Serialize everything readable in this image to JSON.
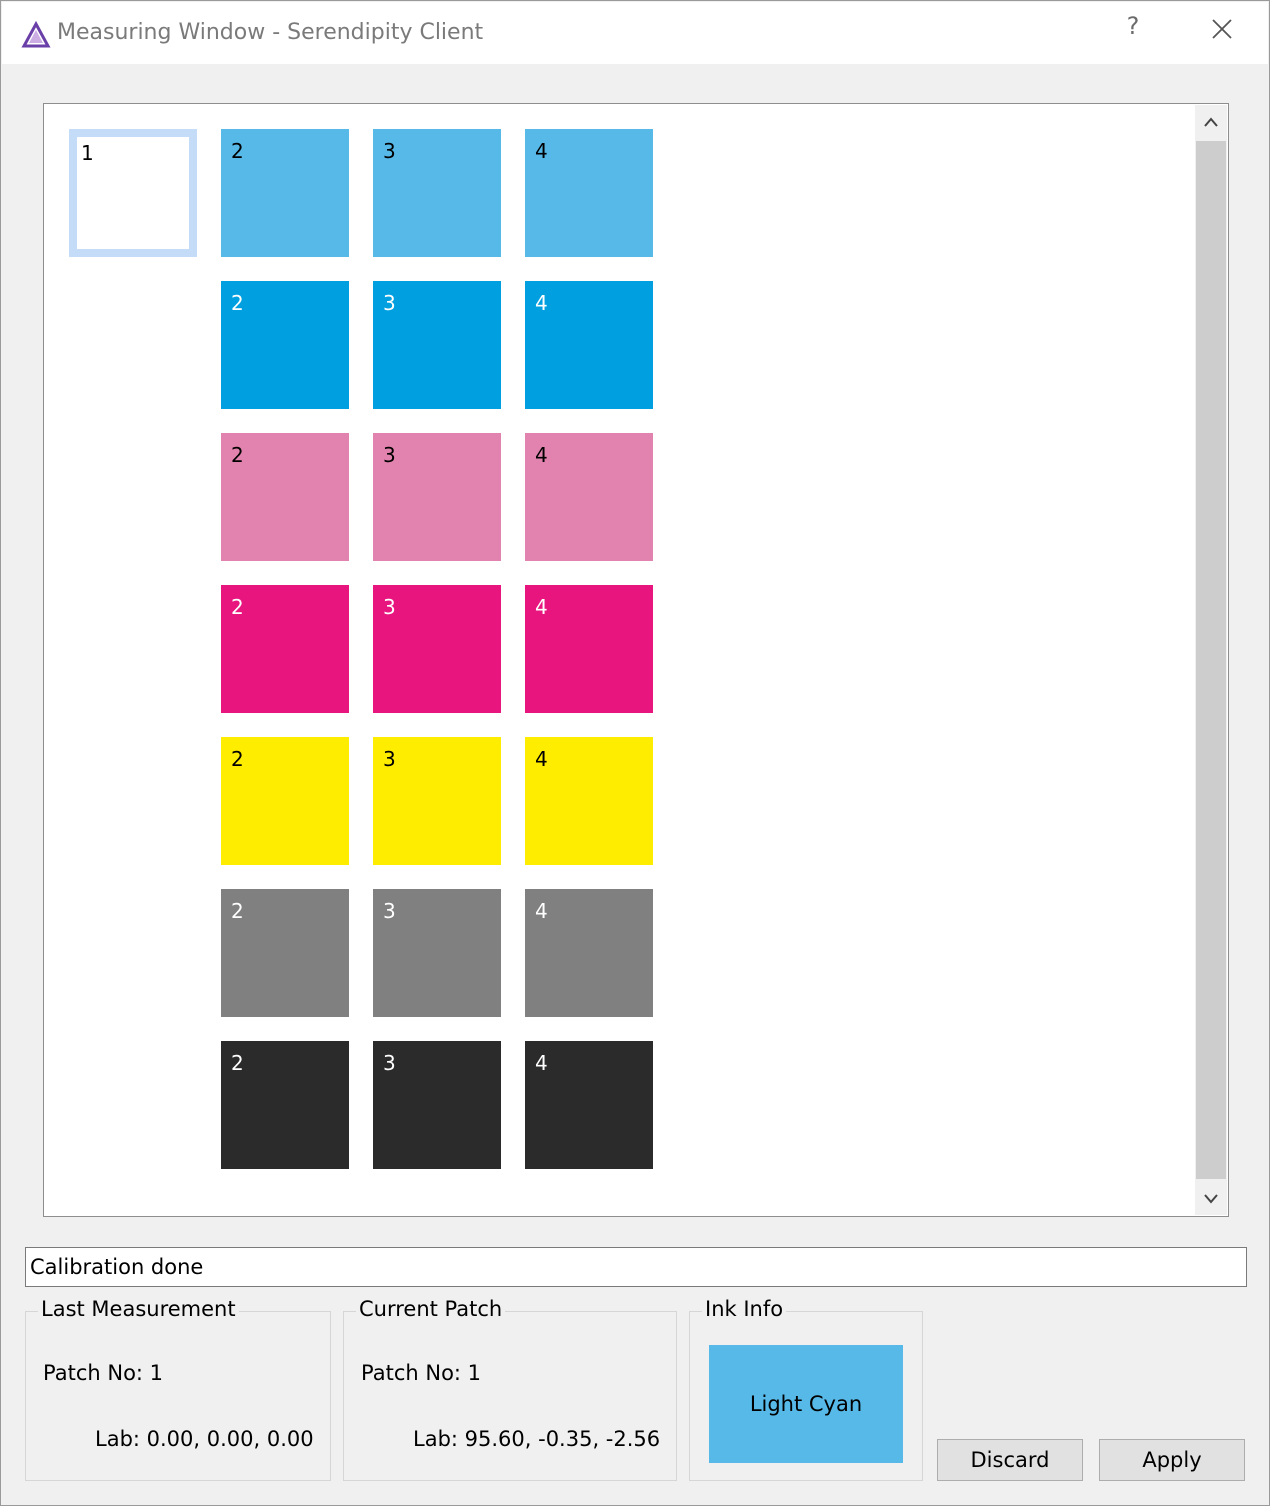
{
  "window": {
    "title": "Measuring Window - Serendipity Client",
    "help_glyph": "?"
  },
  "patches": {
    "first": {
      "label": "1",
      "color": "#ffffff",
      "text_color": "#000000"
    },
    "rows": [
      {
        "name": "light-cyan",
        "color": "#56b9e8",
        "text_color": "#000000",
        "labels": [
          "2",
          "3",
          "4"
        ]
      },
      {
        "name": "cyan",
        "color": "#00a0e0",
        "text_color": "#ffffff",
        "labels": [
          "2",
          "3",
          "4"
        ]
      },
      {
        "name": "light-magenta",
        "color": "#e183ae",
        "text_color": "#000000",
        "labels": [
          "2",
          "3",
          "4"
        ]
      },
      {
        "name": "magenta",
        "color": "#e8157f",
        "text_color": "#ffffff",
        "labels": [
          "2",
          "3",
          "4"
        ]
      },
      {
        "name": "yellow",
        "color": "#ffed00",
        "text_color": "#000000",
        "labels": [
          "2",
          "3",
          "4"
        ]
      },
      {
        "name": "gray",
        "color": "#808080",
        "text_color": "#ffffff",
        "labels": [
          "2",
          "3",
          "4"
        ]
      },
      {
        "name": "black",
        "color": "#2b2b2b",
        "text_color": "#ffffff",
        "labels": [
          "2",
          "3",
          "4"
        ]
      }
    ]
  },
  "status": {
    "text": "Calibration done"
  },
  "last_measurement": {
    "title": "Last Measurement",
    "patch_no": "Patch No:  1",
    "lab": "Lab:  0.00, 0.00, 0.00"
  },
  "current_patch": {
    "title": "Current Patch",
    "patch_no": "Patch No:  1",
    "lab": "Lab:  95.60, -0.35, -2.56"
  },
  "ink_info": {
    "title": "Ink Info",
    "ink_name": "Light Cyan",
    "swatch_color": "#56b9e8"
  },
  "buttons": {
    "discard": "Discard",
    "apply": "Apply"
  },
  "icons": {
    "app": "serendipity-logo-icon",
    "close": "close-icon",
    "scroll_up": "chevron-up-icon",
    "scroll_down": "chevron-down-icon"
  }
}
